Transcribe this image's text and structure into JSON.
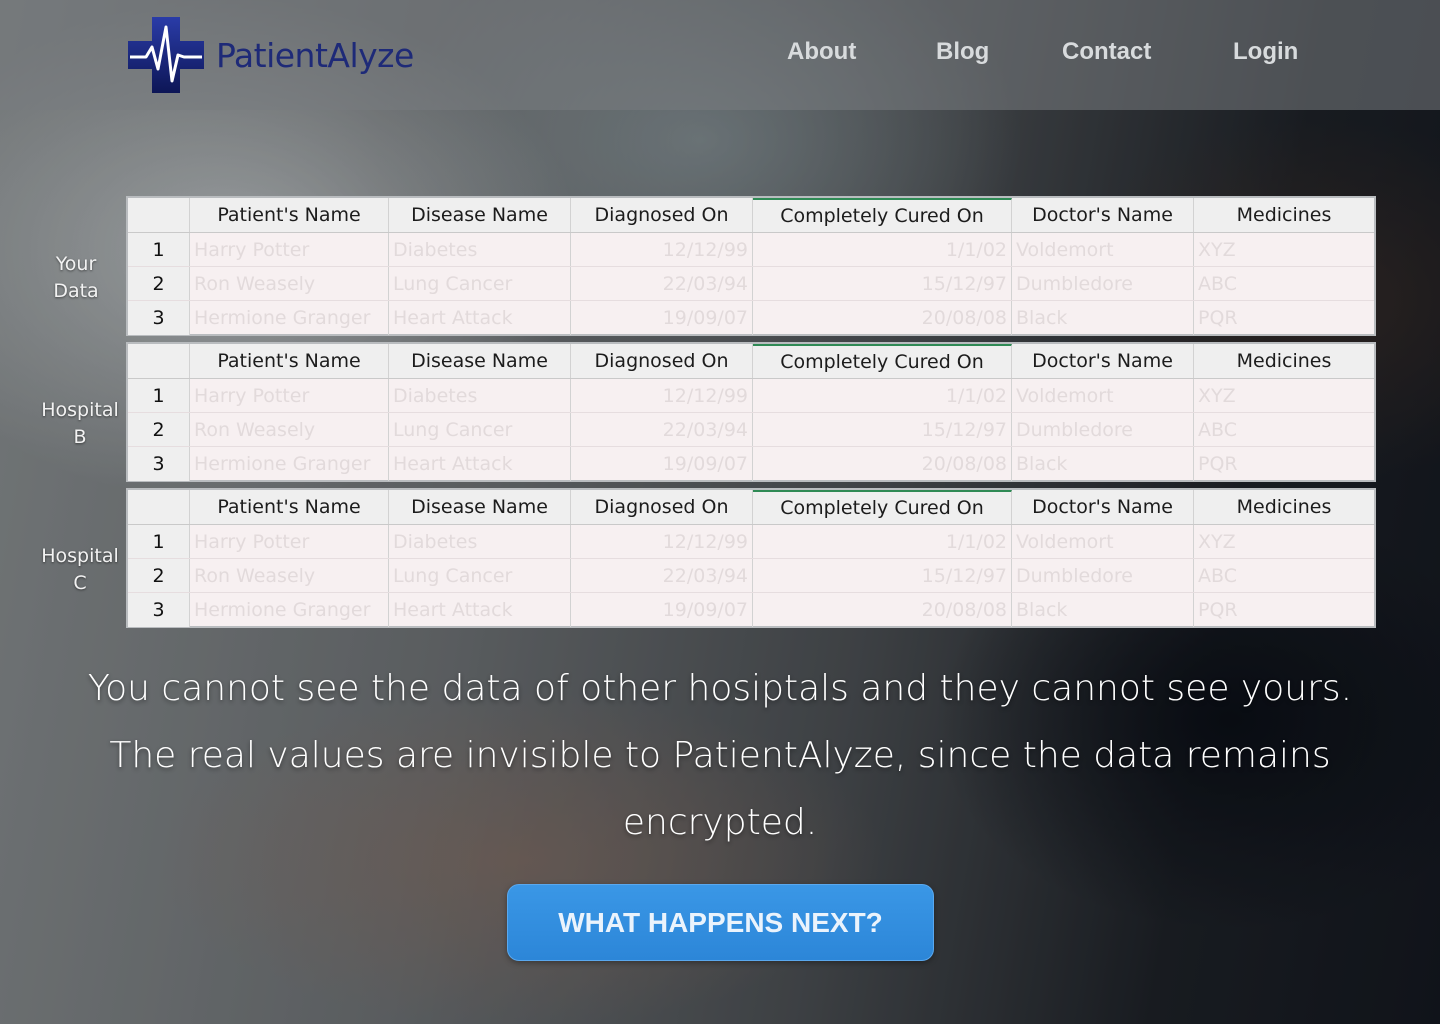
{
  "brand": {
    "name": "PatientAlyze"
  },
  "nav": {
    "about": "About",
    "blog": "Blog",
    "contact": "Contact",
    "login": "Login"
  },
  "tables": [
    {
      "label_line1": "Your",
      "label_line2": "Data"
    },
    {
      "label_line1": "Hospital",
      "label_line2": "B"
    },
    {
      "label_line1": "Hospital",
      "label_line2": "C"
    }
  ],
  "columns": [
    "Patient's Name",
    "Disease Name",
    "Diagnosed On",
    "Completely Cured On",
    "Doctor's Name",
    "Medicines"
  ],
  "rows": [
    {
      "num": "1",
      "patient": "Harry Potter",
      "disease": "Diabetes",
      "diagnosed": "12/12/99",
      "cured": "1/1/02",
      "doctor": "Voldemort",
      "medicine": "XYZ"
    },
    {
      "num": "2",
      "patient": "Ron Weasely",
      "disease": "Lung Cancer",
      "diagnosed": "22/03/94",
      "cured": "15/12/97",
      "doctor": "Dumbledore",
      "medicine": "ABC"
    },
    {
      "num": "3",
      "patient": "Hermione Granger",
      "disease": "Heart Attack",
      "diagnosed": "19/09/07",
      "cured": "20/08/08",
      "doctor": "Black",
      "medicine": "PQR"
    }
  ],
  "message": {
    "line1": "You cannot see the data of other hosiptals and they cannot see yours.",
    "line2": "The real values are invisible to PatientAlyze, since the data remains encrypted."
  },
  "cta": {
    "label": "WHAT HAPPENS NEXT?"
  },
  "colors": {
    "brand": "#1e2a78",
    "cta": "#2c86d8"
  }
}
